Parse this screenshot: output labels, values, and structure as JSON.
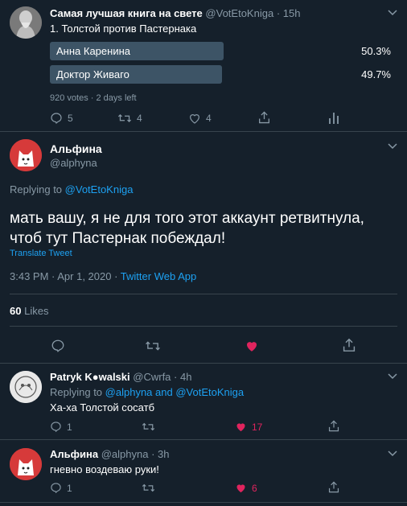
{
  "tweet1": {
    "name": "Самая лучшая книга на свете",
    "handle": "@VotEtoKniga",
    "time": "15h",
    "text": "1. Толстой против Пастернака",
    "poll": [
      {
        "label": "Анна Каренина",
        "percent": "50.3%",
        "share": 0.503
      },
      {
        "label": "Доктор Живаго",
        "percent": "49.7%",
        "share": 0.497
      }
    ],
    "poll_meta": "920 votes · 2 days left",
    "replies": "5",
    "retweets": "4",
    "likes": "4"
  },
  "main": {
    "name": "Альфина",
    "handle": "@alphyna",
    "replying_label": "Replying to",
    "replying_to": "@VotEtoKniga",
    "text_line1": "мать вашу, я не для того этот аккаунт ретвитнула,",
    "text_line2": "чтоб тут Пастернак побеждал!",
    "translate": "Translate Tweet",
    "date": "3:43 PM · Apr 1, 2020 · ",
    "source": "Twitter Web App",
    "likes_count": "60",
    "likes_label": "Likes"
  },
  "reply1": {
    "name": "Patryk K●walski",
    "handle": "@Cwrfa",
    "time": "· 4h",
    "replying_label": "Replying to",
    "replying_to": "@alphyna and @VotEtoKniga",
    "text": "Ха-ха Толстой сосатб",
    "replies": "1",
    "likes": "17"
  },
  "reply2": {
    "name": "Альфина",
    "handle": "@alphyna",
    "time": "· 3h",
    "text": "гневно воздеваю руки!",
    "replies": "1",
    "likes": "6"
  },
  "colors": {
    "background": "#15202b",
    "link": "#1da1f2",
    "muted": "#8899a6",
    "like": "#e0245e",
    "poll_bar": "#3d5466"
  }
}
